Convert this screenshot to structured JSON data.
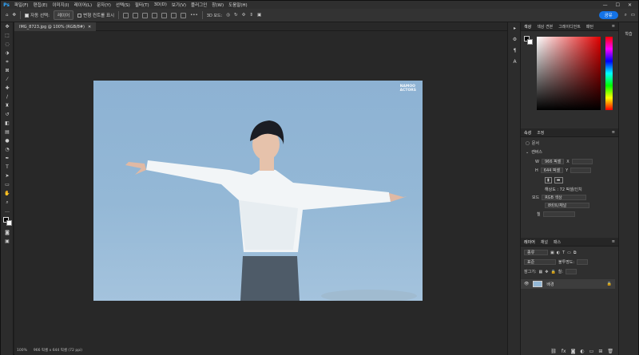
{
  "menubar": {
    "app_icon": "Ps",
    "items": [
      "파일(F)",
      "편집(E)",
      "이미지(I)",
      "레이어(L)",
      "문자(Y)",
      "선택(S)",
      "필터(T)",
      "3D(D)",
      "보기(V)",
      "플러그인",
      "창(W)",
      "도움말(H)"
    ],
    "window_controls": [
      "—",
      "☐",
      "✕"
    ]
  },
  "options": {
    "auto_select_label": "자동 선택:",
    "auto_select_value": "레이어",
    "transform_controls_label": "변형 컨트롤 표시",
    "more": "•••",
    "share_label": "공유"
  },
  "document": {
    "tab_title": "IMG_8723.jpg @ 100% (RGB/8#)",
    "watermark": [
      "NAMOO",
      "ACTORS"
    ]
  },
  "status": {
    "zoom": "100%",
    "info": "966 픽셀 x 644 픽셀 (72 ppi)"
  },
  "color_panel": {
    "tabs": [
      "색상",
      "색상 견본",
      "그레이디언트",
      "패턴"
    ],
    "fg": "#000000",
    "bg": "#ffffff"
  },
  "props_panel": {
    "tabs": [
      "속성",
      "조정"
    ],
    "doc_label": "문서",
    "section": "캔버스",
    "w_label": "W",
    "w_value": "966 픽셀",
    "h_label": "H",
    "h_value": "644 픽셀",
    "x_label": "X",
    "y_label": "Y",
    "resolution": "해상도 : 72 픽셀/인치",
    "mode_label": "모드",
    "mode_value": "RGB 색상",
    "bit_value": "8비트/채널",
    "fill_label": "칠"
  },
  "layers_panel": {
    "tabs": [
      "레이어",
      "채널",
      "패스"
    ],
    "kind_label": "종류",
    "blend_label": "표준",
    "opacity_label": "불투명도:",
    "lock_label": "잠그기:",
    "fill_label": "칠:",
    "layer_name": "배경"
  },
  "right_strip": {
    "label": "학습"
  }
}
